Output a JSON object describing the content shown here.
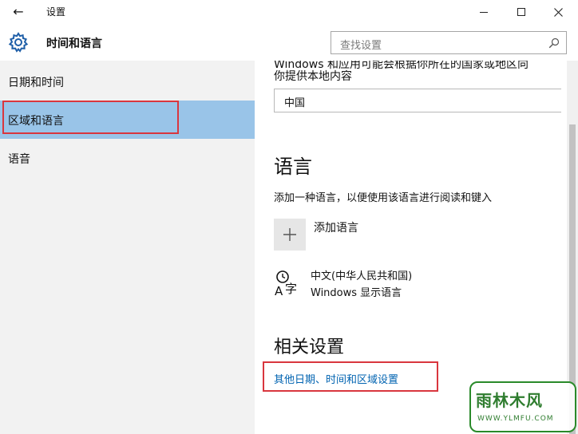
{
  "window": {
    "title": "设置",
    "back_glyph": "←"
  },
  "header": {
    "title": "时间和语言",
    "search_placeholder": "查找设置"
  },
  "sidebar": {
    "items": [
      {
        "label": "日期和时间",
        "selected": false
      },
      {
        "label": "区域和语言",
        "selected": true
      },
      {
        "label": "语音",
        "selected": false
      }
    ]
  },
  "main": {
    "region_desc_partial": "Windows 和应用可能会根据你所在的国家或地区向",
    "region_desc_line2": "你提供本地内容",
    "region_value": "中国",
    "language_heading": "语言",
    "language_desc": "添加一种语言，以便使用该语言进行阅读和键入",
    "add_language_label": "添加语言",
    "installed_language": {
      "name": "中文(中华人民共和国)",
      "subtitle": "Windows 显示语言"
    },
    "related_heading": "相关设置",
    "related_link": "其他日期、时间和区域设置"
  },
  "watermark": {
    "title": "雨林木风",
    "url": "WWW.YLMFU.COM"
  },
  "colors": {
    "selected_nav": "#99c4e8",
    "sidebar_bg": "#f2f2f2",
    "link": "#0063b1",
    "highlight_border": "#d9363e"
  }
}
